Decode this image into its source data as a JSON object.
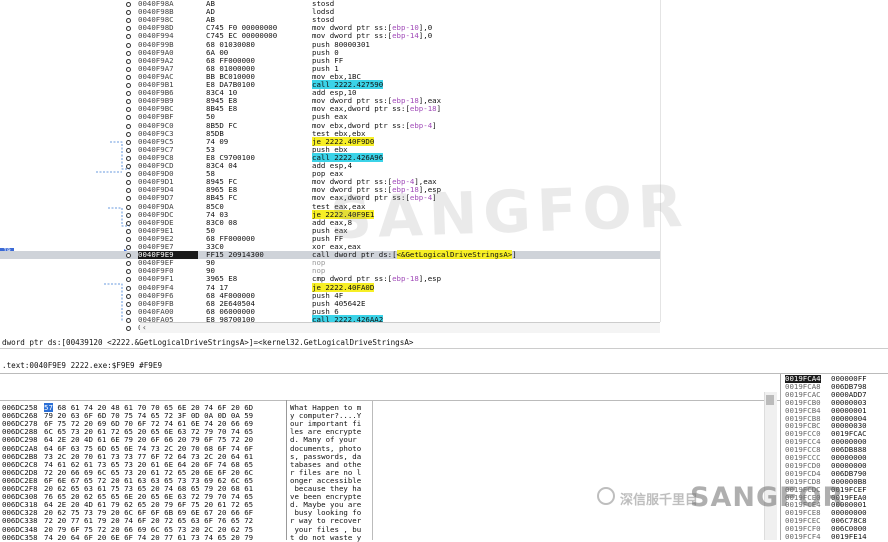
{
  "disasm": {
    "ip_label": "IP",
    "rows": [
      {
        "addr": "0040F98A",
        "hex": "AB",
        "ins": [
          {
            "t": "stosd"
          }
        ]
      },
      {
        "addr": "0040F98B",
        "hex": "AD",
        "ins": [
          {
            "t": "lodsd"
          }
        ]
      },
      {
        "addr": "0040F98C",
        "hex": "AB",
        "ins": [
          {
            "t": "stosd"
          }
        ]
      },
      {
        "addr": "0040F98D",
        "hex": "C745 F0 00000000",
        "ins": [
          {
            "t": "mov dword ptr ss:["
          },
          {
            "t": "ebp-10",
            "c": "p"
          },
          {
            "t": "],0"
          }
        ]
      },
      {
        "addr": "0040F994",
        "hex": "C745 EC 00000000",
        "ins": [
          {
            "t": "mov dword ptr ss:["
          },
          {
            "t": "ebp-14",
            "c": "p"
          },
          {
            "t": "],0"
          }
        ]
      },
      {
        "addr": "0040F99B",
        "hex": "68 01030080",
        "ins": [
          {
            "t": "push 80000301"
          }
        ]
      },
      {
        "addr": "0040F9A0",
        "hex": "6A 00",
        "ins": [
          {
            "t": "push 0"
          }
        ]
      },
      {
        "addr": "0040F9A2",
        "hex": "68 FF000000",
        "ins": [
          {
            "t": "push FF"
          }
        ]
      },
      {
        "addr": "0040F9A7",
        "hex": "68 01000000",
        "ins": [
          {
            "t": "push 1"
          }
        ]
      },
      {
        "addr": "0040F9AC",
        "hex": "BB BC010000",
        "ins": [
          {
            "t": "mov ebx,1BC"
          }
        ]
      },
      {
        "addr": "0040F9B1",
        "hex": "E8 DA7B0100",
        "ins": [
          {
            "t": "call 2222.427590",
            "c": "c"
          }
        ]
      },
      {
        "addr": "0040F9B6",
        "hex": "83C4 10",
        "ins": [
          {
            "t": "add esp,10"
          }
        ]
      },
      {
        "addr": "0040F9B9",
        "hex": "8945 E8",
        "ins": [
          {
            "t": "mov dword ptr ss:["
          },
          {
            "t": "ebp-18",
            "c": "p"
          },
          {
            "t": "],eax"
          }
        ]
      },
      {
        "addr": "0040F9BC",
        "hex": "8B45 E8",
        "ins": [
          {
            "t": "mov eax,dword ptr ss:["
          },
          {
            "t": "ebp-18",
            "c": "p"
          },
          {
            "t": "]"
          }
        ]
      },
      {
        "addr": "0040F9BF",
        "hex": "50",
        "ins": [
          {
            "t": "push eax"
          }
        ]
      },
      {
        "addr": "0040F9C0",
        "hex": "8B5D FC",
        "ins": [
          {
            "t": "mov ebx,dword ptr ss:["
          },
          {
            "t": "ebp-4",
            "c": "p"
          },
          {
            "t": "]"
          }
        ]
      },
      {
        "addr": "0040F9C3",
        "hex": "85DB",
        "ins": [
          {
            "t": "test ebx,ebx"
          }
        ]
      },
      {
        "addr": "0040F9C5",
        "hex": "74 09",
        "ins": [
          {
            "t": "je 2222.40F9D0",
            "c": "y"
          }
        ]
      },
      {
        "addr": "0040F9C7",
        "hex": "53",
        "ins": [
          {
            "t": "push ebx"
          }
        ]
      },
      {
        "addr": "0040F9C8",
        "hex": "E8 C9700100",
        "ins": [
          {
            "t": "call 2222.426A96",
            "c": "c"
          }
        ]
      },
      {
        "addr": "0040F9CD",
        "hex": "83C4 04",
        "ins": [
          {
            "t": "add esp,4"
          }
        ]
      },
      {
        "addr": "0040F9D0",
        "hex": "58",
        "ins": [
          {
            "t": "pop eax"
          }
        ]
      },
      {
        "addr": "0040F9D1",
        "hex": "8945 FC",
        "ins": [
          {
            "t": "mov dword ptr ss:["
          },
          {
            "t": "ebp-4",
            "c": "p"
          },
          {
            "t": "],eax"
          }
        ]
      },
      {
        "addr": "0040F9D4",
        "hex": "8965 E8",
        "ins": [
          {
            "t": "mov dword ptr ss:["
          },
          {
            "t": "ebp-18",
            "c": "p"
          },
          {
            "t": "],esp"
          }
        ]
      },
      {
        "addr": "0040F9D7",
        "hex": "8B45 FC",
        "ins": [
          {
            "t": "mov eax,dword ptr ss:["
          },
          {
            "t": "ebp-4",
            "c": "p"
          },
          {
            "t": "]"
          }
        ]
      },
      {
        "addr": "0040F9DA",
        "hex": "85C0",
        "ins": [
          {
            "t": "test eax,eax"
          }
        ]
      },
      {
        "addr": "0040F9DC",
        "hex": "74 03",
        "ins": [
          {
            "t": "je 2222.40F9E1",
            "c": "y"
          }
        ]
      },
      {
        "addr": "0040F9DE",
        "hex": "83C0 08",
        "ins": [
          {
            "t": "add eax,8"
          }
        ]
      },
      {
        "addr": "0040F9E1",
        "hex": "50",
        "ins": [
          {
            "t": "push eax"
          }
        ]
      },
      {
        "addr": "0040F9E2",
        "hex": "68 FF000000",
        "ins": [
          {
            "t": "push FF"
          }
        ]
      },
      {
        "addr": "0040F9E7",
        "hex": "33C0",
        "ins": [
          {
            "t": "xor eax,eax"
          }
        ]
      },
      {
        "addr": "0040F9E9",
        "hex": "FF15 20914300",
        "ins": [
          {
            "t": "call dword ptr ds:["
          },
          {
            "t": "<&GetLogicalDriveStringsA>",
            "c": "y"
          },
          {
            "t": "]"
          }
        ],
        "cur": true
      },
      {
        "addr": "0040F9EF",
        "hex": "90",
        "ins": [
          {
            "t": "nop",
            "c": "g"
          }
        ]
      },
      {
        "addr": "0040F9F0",
        "hex": "90",
        "ins": [
          {
            "t": "nop",
            "c": "g"
          }
        ]
      },
      {
        "addr": "0040F9F1",
        "hex": "3965 E8",
        "ins": [
          {
            "t": "cmp dword ptr ss:["
          },
          {
            "t": "ebp-18",
            "c": "p"
          },
          {
            "t": "],esp"
          }
        ]
      },
      {
        "addr": "0040F9F4",
        "hex": "74 17",
        "ins": [
          {
            "t": "je 2222.40FA0D",
            "c": "y"
          }
        ]
      },
      {
        "addr": "0040F9F6",
        "hex": "68 4F000000",
        "ins": [
          {
            "t": "push 4F"
          }
        ]
      },
      {
        "addr": "0040F9FB",
        "hex": "68 2E640504",
        "ins": [
          {
            "t": "push 405642E"
          }
        ]
      },
      {
        "addr": "0040FA00",
        "hex": "68 06000000",
        "ins": [
          {
            "t": "push 6"
          }
        ]
      },
      {
        "addr": "0040FA05",
        "hex": "E8 98700100",
        "ins": [
          {
            "t": "call 2222.426AA2",
            "c": "c"
          }
        ]
      },
      {
        "addr": "0040FA0A",
        "hex": "83C4 0C",
        "ins": [
          {
            "t": "add esp,C"
          }
        ]
      }
    ]
  },
  "info": {
    "line1": "dword ptr ds:[00439120 <2222.&GetLogicalDriveStringsA>]=<kernel32.GetLogicalDriveStringsA>",
    "line2": ".text:0040F9E9 2222.exe:$F9E9 #F9E9"
  },
  "dump": {
    "rows": [
      {
        "addr": "006DC258",
        "hex": "57 68 61 74 20 48 61 70 70 65 6E 20 74 6F 20 6D",
        "ascii": "What Happen to m"
      },
      {
        "addr": "006DC268",
        "hex": "79 20 63 6F 6D 70 75 74 65 72 3F 0D 0A 0D 0A 59",
        "ascii": "y computer?....Y"
      },
      {
        "addr": "006DC278",
        "hex": "6F 75 72 20 69 6D 70 6F 72 74 61 6E 74 20 66 69",
        "ascii": "our important fi"
      },
      {
        "addr": "006DC288",
        "hex": "6C 65 73 20 61 72 65 20 65 6E 63 72 79 70 74 65",
        "ascii": "les are encrypte"
      },
      {
        "addr": "006DC298",
        "hex": "64 2E 20 4D 61 6E 79 20 6F 66 20 79 6F 75 72 20",
        "ascii": "d. Many of your "
      },
      {
        "addr": "006DC2A8",
        "hex": "64 6F 63 75 6D 65 6E 74 73 2C 20 70 68 6F 74 6F",
        "ascii": "documents, photo"
      },
      {
        "addr": "006DC2B8",
        "hex": "73 2C 20 70 61 73 73 77 6F 72 64 73 2C 20 64 61",
        "ascii": "s, passwords, da"
      },
      {
        "addr": "006DC2C8",
        "hex": "74 61 62 61 73 65 73 20 61 6E 64 20 6F 74 68 65",
        "ascii": "tabases and othe"
      },
      {
        "addr": "006DC2D8",
        "hex": "72 20 66 69 6C 65 73 20 61 72 65 20 6E 6F 20 6C",
        "ascii": "r files are no l"
      },
      {
        "addr": "006DC2E8",
        "hex": "6F 6E 67 65 72 20 61 63 63 65 73 73 69 62 6C 65",
        "ascii": "onger accessible"
      },
      {
        "addr": "006DC2F8",
        "hex": "20 62 65 63 61 75 73 65 20 74 68 65 79 20 68 61",
        "ascii": " because they ha"
      },
      {
        "addr": "006DC308",
        "hex": "76 65 20 62 65 65 6E 20 65 6E 63 72 79 70 74 65",
        "ascii": "ve been encrypte"
      },
      {
        "addr": "006DC318",
        "hex": "64 2E 20 4D 61 79 62 65 20 79 6F 75 20 61 72 65",
        "ascii": "d. Maybe you are"
      },
      {
        "addr": "006DC328",
        "hex": "20 62 75 73 79 20 6C 6F 6F 6B 69 6E 67 20 66 6F",
        "ascii": " busy looking fo"
      },
      {
        "addr": "006DC338",
        "hex": "72 20 77 61 79 20 74 6F 20 72 65 63 6F 76 65 72",
        "ascii": "r way to recover"
      },
      {
        "addr": "006DC348",
        "hon": "",
        "hex": "20 79 6F 75 72 20 66 69 6C 65 73 20 2C 20 62 75",
        "ascii": " your files , bu"
      },
      {
        "addr": "006DC358",
        "hex": "74 20 64 6F 20 6E 6F 74 20 77 61 73 74 65 20 79",
        "ascii": "t do not waste y"
      }
    ]
  },
  "stack": {
    "rows": [
      {
        "a": "0019FCA4",
        "v": "000000FF",
        "cur": true
      },
      {
        "a": "0019FCA8",
        "v": "006DB798"
      },
      {
        "a": "0019FCAC",
        "v": "0000ADD7"
      },
      {
        "a": "0019FCB0",
        "v": "00000003"
      },
      {
        "a": "0019FCB4",
        "v": "00000001"
      },
      {
        "a": "0019FCB8",
        "v": "00000004"
      },
      {
        "a": "0019FCBC",
        "v": "00000030"
      },
      {
        "a": "0019FCC0",
        "v": "0019FCAC"
      },
      {
        "a": "0019FCC4",
        "v": "00000000"
      },
      {
        "a": "0019FCC8",
        "v": "006DB888"
      },
      {
        "a": "0019FCCC",
        "v": "00000000"
      },
      {
        "a": "0019FCD0",
        "v": "00000000"
      },
      {
        "a": "0019FCD4",
        "v": "006DB790"
      },
      {
        "a": "0019FCD8",
        "v": "000000B8"
      },
      {
        "a": "0019FCDC",
        "v": "0019FCEF"
      },
      {
        "a": "0019FCE0",
        "v": "0019FEA0"
      },
      {
        "a": "0019FCE4",
        "v": "00000001"
      },
      {
        "a": "0019FCE8",
        "v": "00000000"
      },
      {
        "a": "0019FCEC",
        "v": "006C78C8"
      },
      {
        "a": "0019FCF0",
        "v": "006C0000"
      },
      {
        "a": "0019FCF4",
        "v": "0019FE14"
      }
    ]
  },
  "watermark": {
    "center": "SANGFOR",
    "brand": "SANGFOR",
    "cn": "深信服千里目"
  },
  "colors": {
    "yellow": "#f7ef25",
    "cyan": "#3bd3e8",
    "purple": "#a04ab8",
    "selection": "#2b6fd6"
  }
}
